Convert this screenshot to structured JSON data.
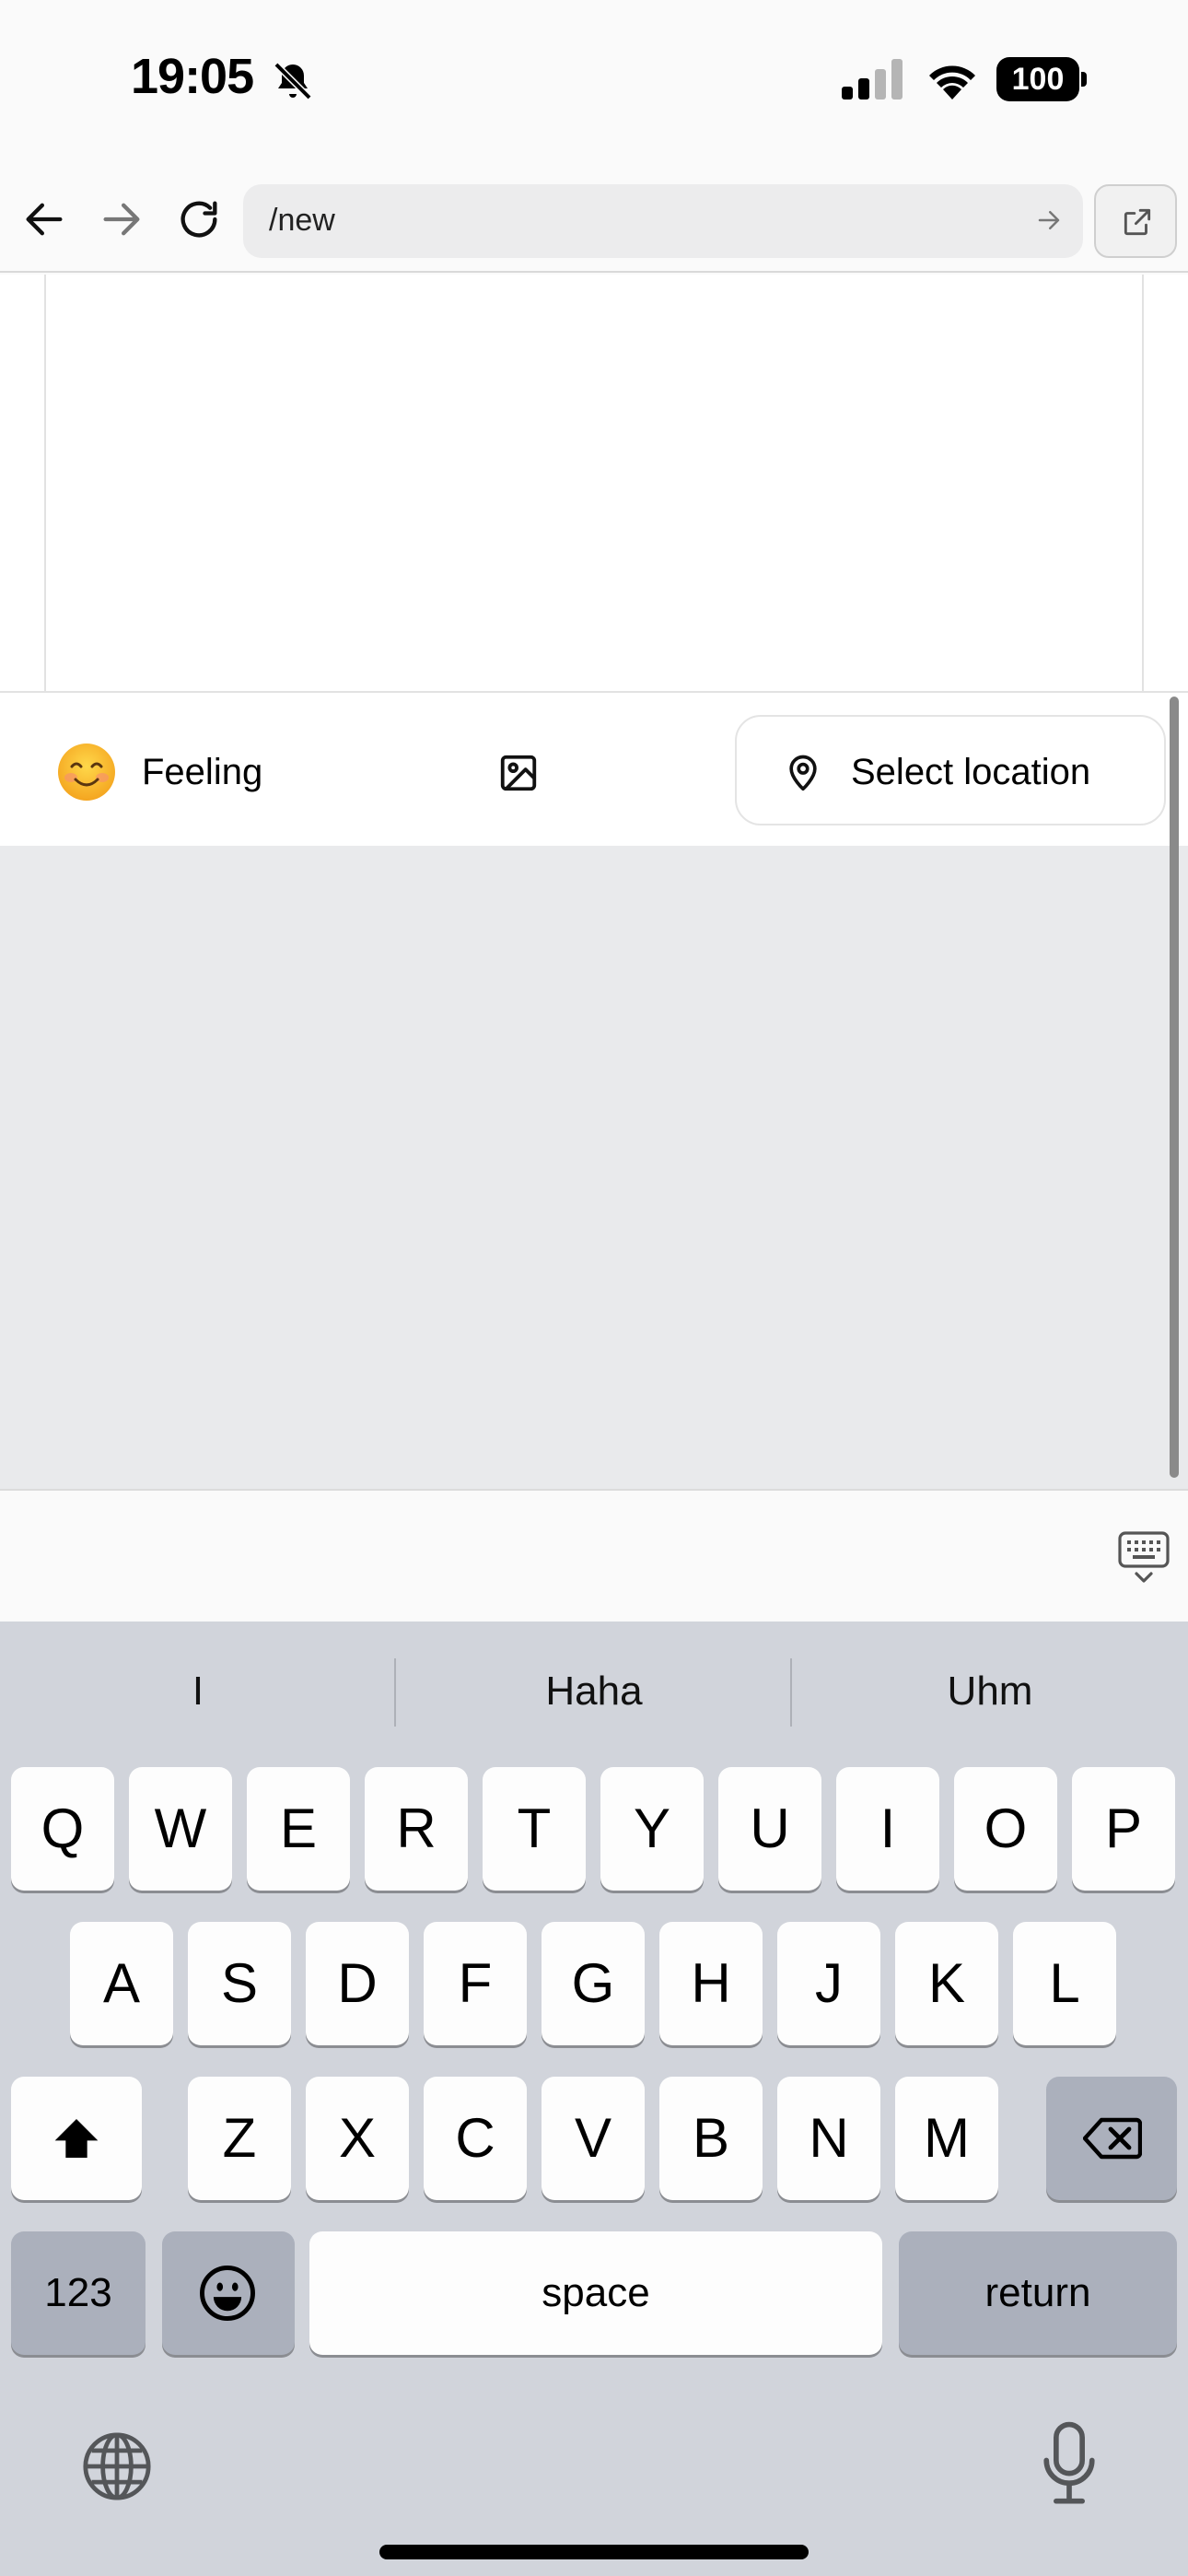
{
  "status_bar": {
    "time": "19:05",
    "battery": "100",
    "icons": [
      "bell-slash-icon",
      "cellular-signal-icon",
      "wifi-icon",
      "battery-icon"
    ]
  },
  "browser": {
    "url": "/new",
    "icons": [
      "back-arrow-icon",
      "forward-arrow-icon",
      "reload-icon",
      "go-arrow-icon",
      "open-external-icon"
    ]
  },
  "toolbar": {
    "feeling_label": "Feeling",
    "location_label": "Select location",
    "icons": [
      "smiling-face-emoji",
      "image-icon",
      "map-pin-icon"
    ]
  },
  "keyboard": {
    "suggestions": [
      "I",
      "Haha",
      "Uhm"
    ],
    "row1": [
      "Q",
      "W",
      "E",
      "R",
      "T",
      "Y",
      "U",
      "I",
      "O",
      "P"
    ],
    "row2": [
      "A",
      "S",
      "D",
      "F",
      "G",
      "H",
      "J",
      "K",
      "L"
    ],
    "row3": [
      "Z",
      "X",
      "C",
      "V",
      "B",
      "N",
      "M"
    ],
    "numbers_label": "123",
    "space_label": "space",
    "return_label": "return",
    "icons": [
      "shift-icon",
      "backspace-icon",
      "emoji-icon",
      "globe-icon",
      "microphone-icon",
      "keyboard-dismiss-icon"
    ]
  },
  "colors": {
    "keyboard_bg": "#d1d4db",
    "key_light": "#fdfdfd",
    "key_dark": "#abb0bc",
    "content_gray": "#e9eaec"
  }
}
